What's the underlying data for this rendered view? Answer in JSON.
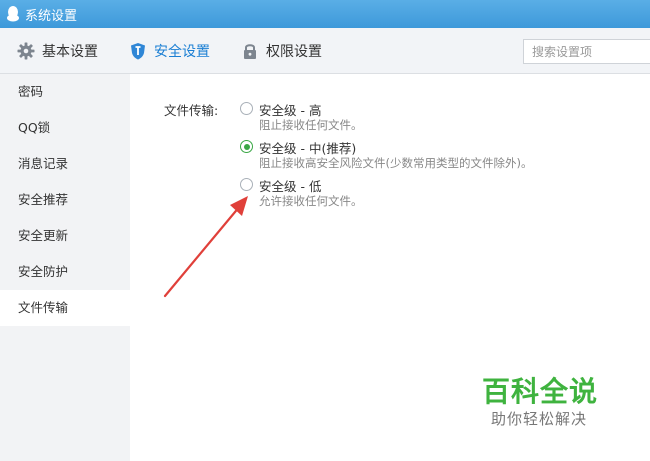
{
  "window": {
    "title": "系统设置"
  },
  "tabs": [
    {
      "label": "基本设置",
      "icon": "gear-icon"
    },
    {
      "label": "安全设置",
      "icon": "shield-icon",
      "active": true
    },
    {
      "label": "权限设置",
      "icon": "lock-icon"
    }
  ],
  "search": {
    "placeholder": "搜索设置项",
    "value": ""
  },
  "sidebar": {
    "items": [
      {
        "label": "密码"
      },
      {
        "label": "QQ锁"
      },
      {
        "label": "消息记录"
      },
      {
        "label": "安全推荐"
      },
      {
        "label": "安全更新"
      },
      {
        "label": "安全防护"
      },
      {
        "label": "文件传输",
        "active": true
      }
    ]
  },
  "file_transfer": {
    "label": "文件传输:",
    "options": [
      {
        "title": "安全级 - 高",
        "desc": "阻止接收任何文件。",
        "checked": false
      },
      {
        "title": "安全级 - 中(推荐)",
        "desc": "阻止接收高安全风险文件(少数常用类型的文件除外)。",
        "checked": true
      },
      {
        "title": "安全级 - 低",
        "desc": "允许接收任何文件。",
        "checked": false
      }
    ]
  },
  "watermark": {
    "title": "百科全说",
    "subtitle": "助你轻松解决"
  },
  "colors": {
    "titlebar": "#3d99da",
    "accent": "#1a7ed3",
    "radio_checked": "#3aa745",
    "arrow": "#e0403a",
    "watermark": "#3fb33f"
  }
}
